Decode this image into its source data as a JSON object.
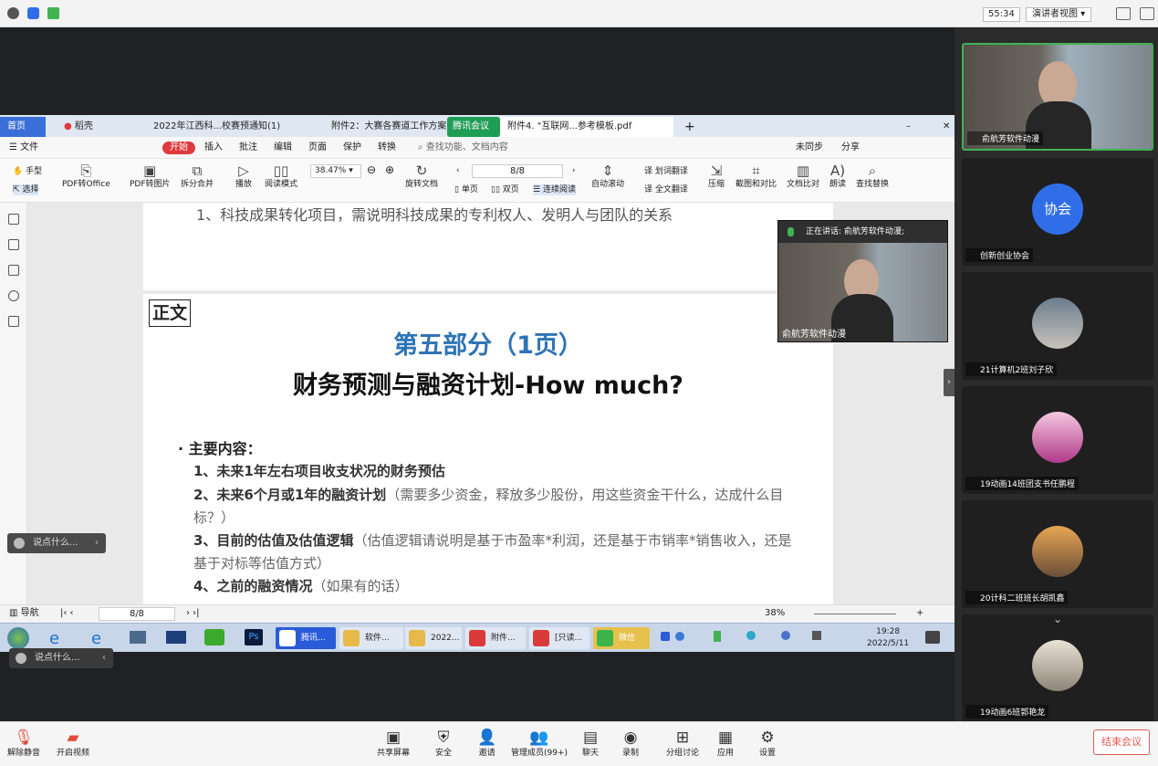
{
  "topbar": {
    "timer": "55:34",
    "presenter_view": "演讲者视图"
  },
  "wps": {
    "tabs": [
      "首页",
      "稻壳",
      "2022年江西科...校赛预通知(1)",
      "附件2：大赛各赛道工作方案",
      "附件4. \"互联网...参考模板.pdf"
    ],
    "meeting_tag": "腾讯会议",
    "menu": {
      "file": "文件",
      "start": "开始",
      "insert": "插入",
      "annotate": "批注",
      "edit": "编辑",
      "page": "页面",
      "protect": "保护",
      "convert": "转换",
      "search": "查找功能、文档内容",
      "unsynced": "未同步",
      "share": "分享"
    },
    "toolbar": {
      "hand": "手型",
      "select": "选择",
      "pdf_office": "PDF转Office",
      "pdf_image": "PDF转图片",
      "split_merge": "拆分合并",
      "play": "播放",
      "read_mode": "阅读模式",
      "zoom": "38.47%",
      "page": "8/8",
      "rotate": "旋转文档",
      "single": "单页",
      "double": "双页",
      "continuous": "连续阅读",
      "auto_scroll": "自动滚动",
      "word_translate": "划词翻译",
      "full_translate": "全文翻译",
      "compress": "压缩",
      "screenshot_compare": "截图和对比",
      "doc_compare": "文档比对",
      "read_aloud": "朗读",
      "find_replace": "查找替换"
    },
    "doc": {
      "page1_text": "1、科技成果转化项目，需说明科技成果的专利权人、发明人与团队的关系",
      "tag": "正文",
      "title": "第五部分（1页）",
      "subtitle": "财务预测与融资计划-How much?",
      "main_head": "主要内容：",
      "items": [
        {
          "bold": "1、未来1年左右项目收支状况的财务预估",
          "note": ""
        },
        {
          "bold": "2、未来6个月或1年的融资计划",
          "note": "（需要多少资金，释放多少股份，用这些资金干什么，达成什么目标？）"
        },
        {
          "bold": "3、目前的估值及估值逻辑",
          "note": "（估值逻辑请说明是基于市盈率*利润，还是基于市销率*销售收入，还是基于对标等估值方式）"
        },
        {
          "bold": "4、之前的融资情况",
          "note": "（如果有的话）"
        }
      ]
    },
    "status": {
      "nav": "导航",
      "page": "8/8",
      "zoom": "38%"
    }
  },
  "taskbar": {
    "items": [
      "腾讯...",
      "软件...",
      "2022...",
      "附件...",
      "[只读...",
      "微信"
    ],
    "time": "19:28",
    "date": "2022/5/11"
  },
  "chat": {
    "placeholder": "说点什么..."
  },
  "speaker_float": {
    "speaking": "正在讲话: 俞航芳软件动漫;",
    "name": "俞航芳软件动漫"
  },
  "participants": [
    {
      "name": "俞航芳软件动漫",
      "avatar": ""
    },
    {
      "name": "创新创业协会",
      "avatar": "协会"
    },
    {
      "name": "21计算机2班刘子欣",
      "avatar": ""
    },
    {
      "name": "19动画14班团支书任鹏程",
      "avatar": ""
    },
    {
      "name": "20计科二班班长胡凯鑫",
      "avatar": ""
    },
    {
      "name": "19动画6班郭艳龙",
      "avatar": ""
    }
  ],
  "bottombar": {
    "unmute": "解除静音",
    "video": "开启视频",
    "share_screen": "共享屏幕",
    "security": "安全",
    "invite": "邀请",
    "members": "管理成员(99+)",
    "chat": "聊天",
    "record": "录制",
    "breakout": "分组讨论",
    "apps": "应用",
    "settings": "设置",
    "end": "结束会议"
  }
}
